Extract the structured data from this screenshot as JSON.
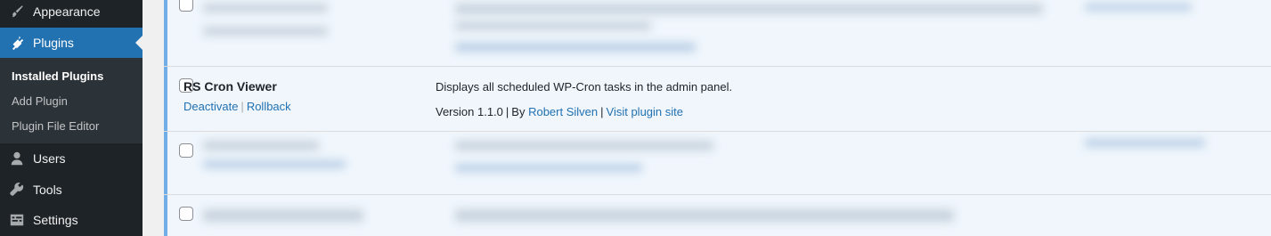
{
  "sidebar": {
    "items": [
      {
        "label": "Appearance",
        "icon": "paintbrush-icon"
      },
      {
        "label": "Plugins",
        "icon": "plugin-icon",
        "current": true
      },
      {
        "label": "Users",
        "icon": "user-icon"
      },
      {
        "label": "Tools",
        "icon": "wrench-icon"
      },
      {
        "label": "Settings",
        "icon": "settings-icon"
      }
    ],
    "submenu": [
      "Installed Plugins",
      "Add Plugin",
      "Plugin File Editor"
    ]
  },
  "plugin": {
    "name": "RS Cron Viewer",
    "actions": {
      "deactivate": "Deactivate",
      "separator": "|",
      "rollback": "Rollback"
    },
    "description": "Displays all scheduled WP-Cron tasks in the admin panel.",
    "meta": {
      "version": "Version 1.1.0",
      "separator": "|",
      "by": "By",
      "author": "Robert Silven",
      "visit": "Visit plugin site"
    }
  },
  "colors": {
    "accent": "#2271b1",
    "sidebar": "#1d2327",
    "active_row": "#f0f6fc",
    "active_border": "#72aee6"
  }
}
